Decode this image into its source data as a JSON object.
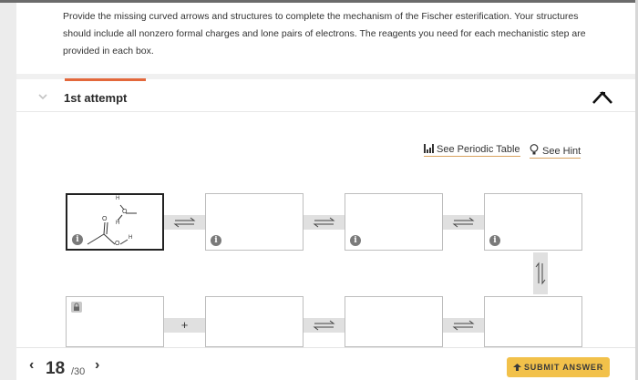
{
  "question": {
    "prompt_line1": "Provide the missing curved arrows and structures to complete the mechanism of the Fischer esterification. Your structures",
    "prompt_line2": "should include all nonzero formal charges and lone pairs of electrons. The reagents you need for each mechanistic step are",
    "prompt_line3": "provided in each box."
  },
  "attempt": {
    "label": "1st attempt"
  },
  "links": {
    "periodic_table": "See Periodic Table",
    "hint": "See Hint"
  },
  "molecule": {
    "atom_h": "H",
    "atom_o": "O"
  },
  "connectors": {
    "plus": "+"
  },
  "footer": {
    "page_current": "18",
    "page_total": "/30",
    "submit_label": "SUBMIT ANSWER"
  },
  "icons": {
    "info": "i",
    "chevron": "chevron-down-icon",
    "collapse": "collapse-arrow-icon",
    "periodic": "periodic-table-icon",
    "hint": "lightbulb-icon",
    "lock": "lock-icon",
    "eq_arrow": "equilibrium-arrow-icon",
    "prev": "‹",
    "next": "›",
    "submit_icon": "submit-icon"
  },
  "colors": {
    "accent": "#e3683b",
    "submit_bg": "#f2c14a",
    "link_underline": "#d9a25e"
  }
}
